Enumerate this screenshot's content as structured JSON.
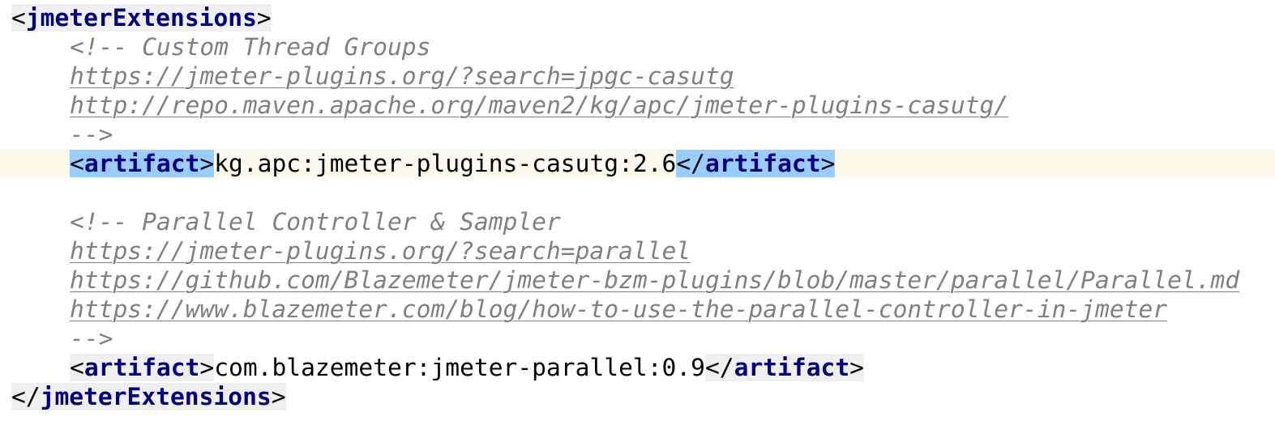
{
  "editor": {
    "root_tag": "jmeterExtensions",
    "artifact_tag": "artifact",
    "blocks": [
      {
        "comment_title": "Custom Thread Groups",
        "links": [
          "https://jmeter-plugins.org/?search=jpgc-casutg",
          "http://repo.maven.apache.org/maven2/kg/apc/jmeter-plugins-casutg/"
        ],
        "artifact": "kg.apc:jmeter-plugins-casutg:2.6"
      },
      {
        "comment_title": "Parallel Controller & Sampler",
        "links": [
          "https://jmeter-plugins.org/?search=parallel",
          "https://github.com/Blazemeter/jmeter-bzm-plugins/blob/master/parallel/Parallel.md",
          "https://www.blazemeter.com/blog/how-to-use-the-parallel-controller-in-jmeter"
        ],
        "artifact": "com.blazemeter:jmeter-parallel:0.9"
      }
    ]
  }
}
